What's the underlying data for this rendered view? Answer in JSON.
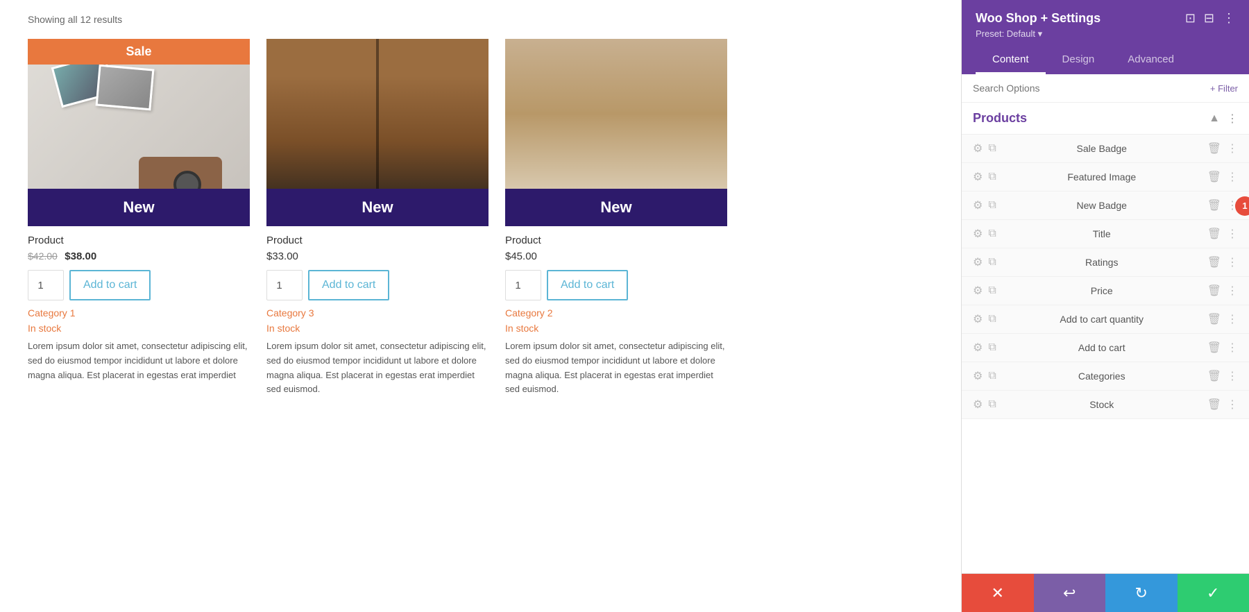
{
  "main": {
    "showing_results": "Showing all 12 results",
    "products": [
      {
        "id": "product-1",
        "sale_badge": "Sale",
        "new_badge": "New",
        "name": "Product",
        "price_old": "$42.00",
        "price_new": "$38.00",
        "qty_default": "1",
        "add_to_cart_label": "Add to cart",
        "category": "Category 1",
        "stock": "In stock",
        "description": "Lorem ipsum dolor sit amet, consectetur adipiscing elit, sed do eiusmod tempor incididunt ut labore et dolore magna aliqua. Est placerat in egestas erat imperdiet"
      },
      {
        "id": "product-2",
        "new_badge": "New",
        "name": "Product",
        "price_regular": "$33.00",
        "qty_default": "1",
        "add_to_cart_label": "Add to cart",
        "category": "Category 3",
        "stock": "In stock",
        "description": "Lorem ipsum dolor sit amet, consectetur adipiscing elit, sed do eiusmod tempor incididunt ut labore et dolore magna aliqua. Est placerat in egestas erat imperdiet sed euismod."
      },
      {
        "id": "product-3",
        "new_badge": "New",
        "name": "Product",
        "price_regular": "$45.00",
        "qty_default": "1",
        "add_to_cart_label": "Add to cart",
        "category": "Category 2",
        "stock": "In stock",
        "description": "Lorem ipsum dolor sit amet, consectetur adipiscing elit, sed do eiusmod tempor incididunt ut labore et dolore magna aliqua. Est placerat in egestas erat imperdiet sed euismod."
      }
    ]
  },
  "panel": {
    "title": "Woo Shop + Settings",
    "preset_label": "Preset: Default ▾",
    "tabs": [
      "Content",
      "Design",
      "Advanced"
    ],
    "active_tab": "Content",
    "search_placeholder": "Search Options",
    "filter_btn_label": "+ Filter",
    "section_title": "Products",
    "notification_badge": "1",
    "modules": [
      {
        "name": "Sale Badge"
      },
      {
        "name": "Featured Image",
        "active": true
      },
      {
        "name": "New Badge"
      },
      {
        "name": "Title"
      },
      {
        "name": "Ratings"
      },
      {
        "name": "Price"
      },
      {
        "name": "Add to cart quantity"
      },
      {
        "name": "Add to cart"
      },
      {
        "name": "Categories"
      },
      {
        "name": "Stock"
      }
    ],
    "toolbar": {
      "cancel": "✕",
      "undo": "↩",
      "redo": "↻",
      "save": "✓"
    }
  }
}
